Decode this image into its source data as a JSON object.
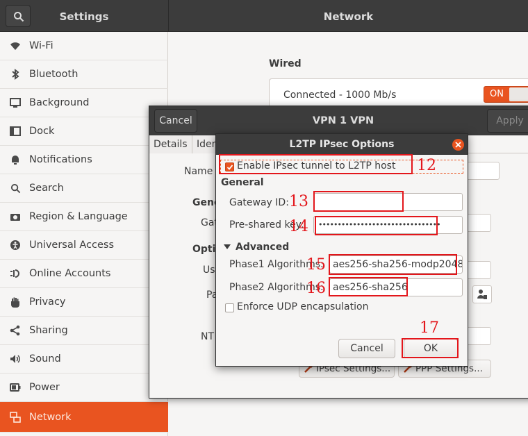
{
  "header": {
    "left_title": "Settings",
    "right_title": "Network"
  },
  "sidebar": {
    "items": [
      {
        "label": "Wi-Fi",
        "icon": "wifi-icon"
      },
      {
        "label": "Bluetooth",
        "icon": "bluetooth-icon"
      },
      {
        "label": "Background",
        "icon": "background-icon"
      },
      {
        "label": "Dock",
        "icon": "dock-icon"
      },
      {
        "label": "Notifications",
        "icon": "bell-icon"
      },
      {
        "label": "Search",
        "icon": "search-icon"
      },
      {
        "label": "Region & Language",
        "icon": "camera-icon"
      },
      {
        "label": "Universal Access",
        "icon": "accessibility-icon"
      },
      {
        "label": "Online Accounts",
        "icon": "online-accounts-icon"
      },
      {
        "label": "Privacy",
        "icon": "hand-icon"
      },
      {
        "label": "Sharing",
        "icon": "share-icon"
      },
      {
        "label": "Sound",
        "icon": "speaker-icon"
      },
      {
        "label": "Power",
        "icon": "power-icon"
      },
      {
        "label": "Network",
        "icon": "network-icon"
      }
    ],
    "active": "Network"
  },
  "network": {
    "wired_heading": "Wired",
    "connection_status": "Connected - 1000 Mb/s",
    "toggle_label": "ON"
  },
  "vpn_dialog": {
    "title": "VPN 1 VPN",
    "cancel": "Cancel",
    "apply": "Apply",
    "tabs": [
      "Details",
      "Identity"
    ],
    "labels": {
      "name": "Name",
      "general": "Gene",
      "gateway": "Gat",
      "options": "Optio",
      "user": "Use",
      "password": "Pa",
      "nt": "NT"
    },
    "ipsec_button": "IPsec Settings...",
    "ppp_button": "PPP Settings..."
  },
  "l2tp_dialog": {
    "title": "L2TP IPsec Options",
    "enable_ipsec": {
      "label": "Enable IPsec tunnel to L2TP host",
      "checked": true
    },
    "general_heading": "General",
    "gateway_id": {
      "label": "Gateway ID:",
      "value": ""
    },
    "psk": {
      "label": "Pre-shared key:",
      "value": "••••••••••••••••••••••••••••••••"
    },
    "advanced_heading": "Advanced",
    "phase1": {
      "label": "Phase1 Algorithms:",
      "value": "aes256-sha256-modp2048"
    },
    "phase2": {
      "label": "Phase2 Algorithms:",
      "value": "aes256-sha256"
    },
    "enforce_udp": {
      "label": "Enforce UDP encapsulation",
      "checked": false
    },
    "cancel": "Cancel",
    "ok": "OK"
  },
  "annotations": [
    "12",
    "13",
    "14",
    "15",
    "16",
    "17"
  ],
  "colors": {
    "accent": "#e95420",
    "annotation": "#e3161b",
    "header": "#3c3c3c"
  }
}
